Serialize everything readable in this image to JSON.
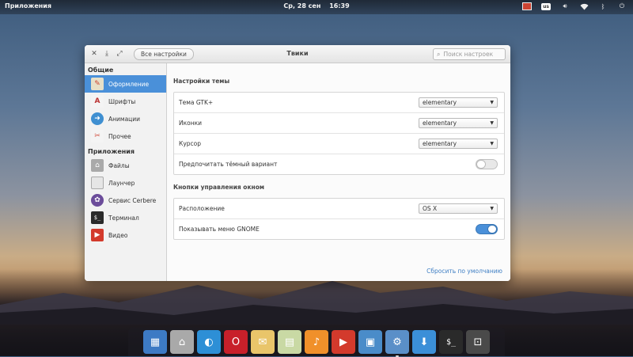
{
  "panel": {
    "apps_label": "Приложения",
    "date": "Ср, 28 сен",
    "time": "16:39",
    "keyboard_layout": "us"
  },
  "window": {
    "title": "Твики",
    "back_label": "Все настройки",
    "search_placeholder": "Поиск настроек"
  },
  "sidebar": {
    "general_header": "Общие",
    "general_items": [
      {
        "label": "Оформление",
        "icon": "appearance-icon",
        "color": "#6a8fc7"
      },
      {
        "label": "Шрифты",
        "icon": "fonts-icon",
        "color": "#444444"
      },
      {
        "label": "Анимации",
        "icon": "animations-icon",
        "color": "#3f8fd1"
      },
      {
        "label": "Прочее",
        "icon": "misc-icon",
        "color": "#d04a3a"
      }
    ],
    "apps_header": "Приложения",
    "app_items": [
      {
        "label": "Файлы",
        "icon": "files-icon",
        "color": "#9a9a9a"
      },
      {
        "label": "Лаунчер",
        "icon": "launcher-icon",
        "color": "#dddddd"
      },
      {
        "label": "Сервис Cerbere",
        "icon": "cerbere-icon",
        "color": "#6b4c9a"
      },
      {
        "label": "Терминал",
        "icon": "terminal-icon",
        "color": "#2a2a2a"
      },
      {
        "label": "Видео",
        "icon": "video-icon",
        "color": "#d33a2c"
      }
    ]
  },
  "theme": {
    "header": "Настройки темы",
    "gtk_label": "Тема GTK+",
    "gtk_value": "elementary",
    "icons_label": "Иконки",
    "icons_value": "elementary",
    "cursor_label": "Курсор",
    "cursor_value": "elementary",
    "dark_label": "Предпочитать тёмный вариант",
    "dark_on": false
  },
  "wm": {
    "header": "Кнопки управления окном",
    "layout_label": "Расположение",
    "layout_value": "OS X",
    "gnome_menu_label": "Показывать меню GNOME",
    "gnome_menu_on": true
  },
  "reset_label": "Сбросить по умолчанию",
  "dock": [
    {
      "name": "multitasking-view",
      "color": "#3d7ac4",
      "glyph": "▦"
    },
    {
      "name": "files",
      "color": "#a9a9a9",
      "glyph": "⌂"
    },
    {
      "name": "midori-browser",
      "color": "#2d8fd6",
      "glyph": "◐"
    },
    {
      "name": "opera-browser",
      "color": "#c8202a",
      "glyph": "O"
    },
    {
      "name": "mail",
      "color": "#e9c56a",
      "glyph": "✉"
    },
    {
      "name": "calendar",
      "color": "#c9d9a4",
      "glyph": "▤"
    },
    {
      "name": "music",
      "color": "#f0902a",
      "glyph": "♪"
    },
    {
      "name": "videos",
      "color": "#d33a2c",
      "glyph": "▶"
    },
    {
      "name": "photos",
      "color": "#4a8cc9",
      "glyph": "▣"
    },
    {
      "name": "system-settings",
      "color": "#5a8fc8",
      "glyph": "⚙"
    },
    {
      "name": "appcenter",
      "color": "#3b8fd8",
      "glyph": "⬇"
    },
    {
      "name": "terminal",
      "color": "#2a2a2a",
      "glyph": "$_"
    },
    {
      "name": "screenshot",
      "color": "#4a4a4a",
      "glyph": "⊡"
    }
  ]
}
